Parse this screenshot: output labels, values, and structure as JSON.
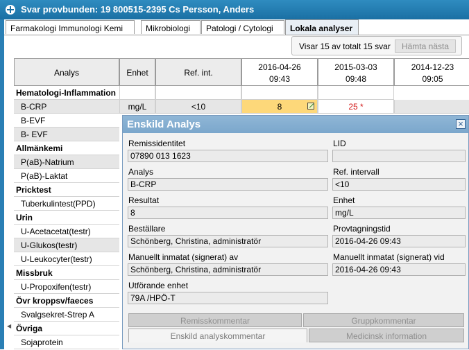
{
  "window": {
    "title": "Svar provbunden: 19 800515-2395 Cs Persson, Anders"
  },
  "tabs": [
    {
      "label": "Farmakologi Immunologi Kemi"
    },
    {
      "label": "Mikrobiologi"
    },
    {
      "label": "Patologi / Cytologi"
    },
    {
      "label": "Lokala analyser"
    }
  ],
  "info": {
    "text": "Visar 15 av totalt 15 svar",
    "fetch_button": "Hämta nästa"
  },
  "table": {
    "headers": {
      "analys": "Analys",
      "enhet": "Enhet",
      "ref": "Ref. int."
    },
    "dates": [
      {
        "date": "2016-04-26",
        "time": "09:43"
      },
      {
        "date": "2015-03-03",
        "time": "09:48"
      },
      {
        "date": "2014-12-23",
        "time": "09:05"
      }
    ],
    "rows": [
      {
        "label": "Hematologi-Inflammation"
      },
      {
        "label": "B-CRP",
        "unit": "mg/L",
        "ref": "<10",
        "v1": "8",
        "v2": "25 *"
      },
      {
        "label": "B-EVF"
      },
      {
        "label": "B- EVF"
      },
      {
        "label": "Allmänkemi"
      },
      {
        "label": "P(aB)-Natrium"
      },
      {
        "label": "P(aB)-Laktat"
      },
      {
        "label": "Pricktest"
      },
      {
        "label": "Tuberkulintest(PPD)"
      },
      {
        "label": "Urin"
      },
      {
        "label": "U-Acetacetat(testr)"
      },
      {
        "label": "U-Glukos(testr)"
      },
      {
        "label": "U-Leukocyter(testr)"
      },
      {
        "label": "Missbruk"
      },
      {
        "label": "U-Propoxifen(testr)"
      },
      {
        "label": "Övr kroppsv/faeces"
      },
      {
        "label": "Svalgsekret-Strep A"
      },
      {
        "label": "Övriga"
      },
      {
        "label": "Sojaprotein"
      }
    ]
  },
  "dialog": {
    "title": "Enskild Analys",
    "remiss_label": "Remissidentitet",
    "remiss_value": "07890 013 1623",
    "lid_label": "LID",
    "lid_value": "",
    "analys_label": "Analys",
    "analys_value": "B-CRP",
    "ref_label": "Ref. intervall",
    "ref_value": "<10",
    "resultat_label": "Resultat",
    "resultat_value": "8",
    "enhet_label": "Enhet",
    "enhet_value": "mg/L",
    "bestallare_label": "Beställare",
    "bestallare_value": "Schönberg, Christina, administratör",
    "provtagning_label": "Provtagningstid",
    "provtagning_value": "2016-04-26 09:43",
    "manuellt_av_label": "Manuellt inmatat (signerat) av",
    "manuellt_av_value": "Schönberg, Christina, administratör",
    "manuellt_vid_label": "Manuellt inmatat (signerat) vid",
    "manuellt_vid_value": "2016-04-26 09:43",
    "utforande_label": "Utförande enhet",
    "utforande_value": "79A /HPÖ-T",
    "bottom_tabs": [
      "Remisskommentar",
      "Gruppkommentar",
      "Enskild analyskommentar",
      "Medicinsk information"
    ]
  },
  "colors": {
    "titlebar": "#1a6fa3",
    "highlight": "#fdd87a",
    "abnormal": "#d21515"
  }
}
